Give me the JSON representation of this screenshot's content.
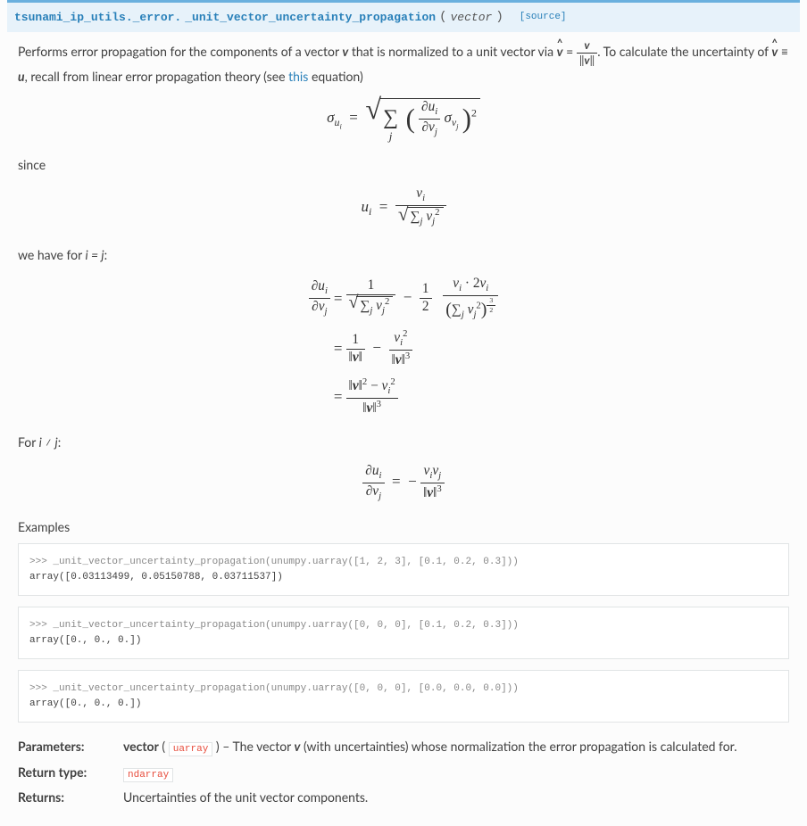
{
  "signature": {
    "module": "tsunami_ip_utils._error.",
    "name": "_unit_vector_uncertainty_propagation",
    "param": "vector",
    "source_label": "[source]"
  },
  "desc": {
    "p1_a": "Performs error propagation for the components of a vector ",
    "p1_b": " that is normalized to a unit vector via ",
    "p1_c": ". To calculate the uncertainty of ",
    "p1_d": ", recall from linear error propagation theory (see ",
    "p1_link": "this",
    "p1_e": " equation)",
    "since": "since",
    "wehave": "we have for ",
    "ij_eq": "i = j",
    "colon": ":",
    "forij": "For ",
    "ij_neq": "i ≠ j",
    "examples": "Examples"
  },
  "code": {
    "ex1_in": ">>> _unit_vector_uncertainty_propagation(unumpy.uarray([1, 2, 3], [0.1, 0.2, 0.3]))",
    "ex1_out": "array([0.03113499, 0.05150788, 0.03711537])",
    "ex2_in": ">>> _unit_vector_uncertainty_propagation(unumpy.uarray([0, 0, 0], [0.1, 0.2, 0.3]))",
    "ex2_out": "array([0., 0., 0.])",
    "ex3_in": ">>> _unit_vector_uncertainty_propagation(unumpy.uarray([0, 0, 0], [0.0, 0.0, 0.0]))",
    "ex3_out": "array([0., 0., 0.])"
  },
  "fields": {
    "params_label": "Parameters:",
    "params_name": "vector",
    "params_type": "uarray",
    "params_desc_a": " – The vector ",
    "params_desc_b": " (with uncertainties) whose normalization the error propagation is calculated for.",
    "rtype_label": "Return type:",
    "rtype_val": "ndarray",
    "returns_label": "Returns:",
    "returns_val": "Uncertainties of the unit vector components."
  }
}
